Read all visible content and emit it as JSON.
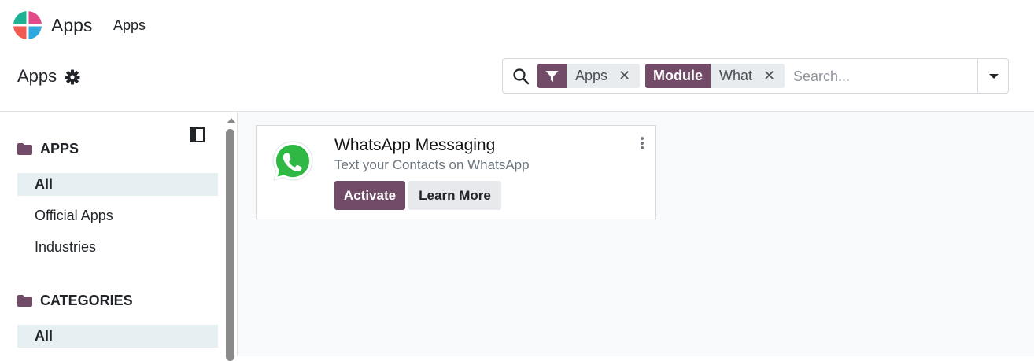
{
  "navbar": {
    "app_name": "Apps",
    "menu_item": "Apps"
  },
  "control_panel": {
    "breadcrumb": "Apps",
    "facets": [
      {
        "tag_icon": "filter-icon",
        "value": "Apps",
        "close": "✕"
      },
      {
        "tag_label": "Module",
        "value": "What",
        "close": "✕"
      }
    ],
    "search_placeholder": "Search..."
  },
  "sidebar": {
    "sections": [
      {
        "title": "APPS",
        "items": [
          "All",
          "Official Apps",
          "Industries"
        ],
        "active": "All"
      },
      {
        "title": "CATEGORIES",
        "items": [
          "All"
        ],
        "active": "All"
      }
    ]
  },
  "card": {
    "title": "WhatsApp Messaging",
    "summary": "Text your Contacts on WhatsApp",
    "activate_label": "Activate",
    "learn_more_label": "Learn More"
  },
  "colors": {
    "primary": "#714b67",
    "active_bg": "#e6f0f2",
    "content_bg": "#f8f9fa",
    "whatsapp_green": "#2fb944"
  }
}
